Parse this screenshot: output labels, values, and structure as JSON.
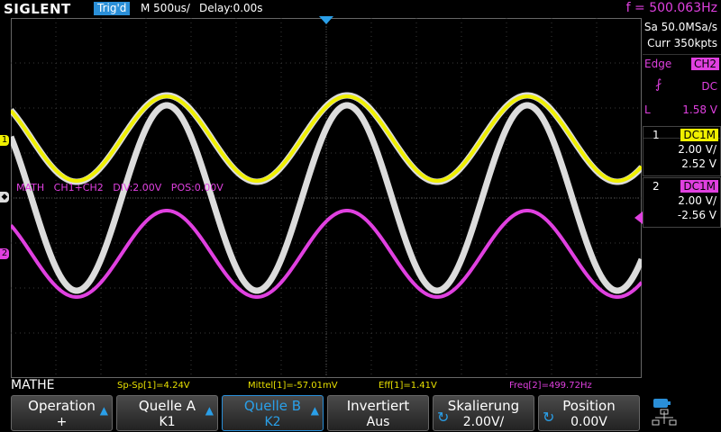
{
  "brand": "SIGLENT",
  "top": {
    "trigger_status": "Trig'd",
    "timebase": "M 500us/",
    "delay": "Delay:0.00s",
    "frequency": "f = 500.063Hz"
  },
  "right_panel": {
    "sample_rate": "Sa 50.0MSa/s",
    "memory": "Curr 350kpts",
    "trigger": {
      "type": "Edge",
      "source": "CH2",
      "slope_symbol": "⨏",
      "coupling": "DC",
      "level_label": "L",
      "level": "1.58 V"
    },
    "channels": [
      {
        "number": "1",
        "coupling": "DC1M",
        "scale": "2.00 V/",
        "offset": "2.52 V",
        "color": "#f0f000"
      },
      {
        "number": "2",
        "coupling": "DC1M",
        "scale": "2.00 V/",
        "offset": "-2.56 V",
        "color": "#e040e0"
      }
    ]
  },
  "math_label": "MATH   CH1+CH2   DIV:2.00V   POS:0.00V",
  "channel_markers": {
    "ch1": "1",
    "ch2": "2"
  },
  "measurement": {
    "menu_title": "MATHE",
    "items": [
      {
        "text": "Sp-Sp[1]=4.24V",
        "color": "#e8e000"
      },
      {
        "text": "Mittel[1]=-57.01mV",
        "color": "#e8e000"
      },
      {
        "text": "Eff[1]=1.41V",
        "color": "#e8e000"
      },
      {
        "text": "Freq[2]=499.72Hz",
        "color": "#e040e0"
      }
    ]
  },
  "softkeys": [
    {
      "label": "Operation",
      "value": "+",
      "arrow": true,
      "knob": false,
      "active": false
    },
    {
      "label": "Quelle A",
      "value": "K1",
      "arrow": true,
      "knob": false,
      "active": false
    },
    {
      "label": "Quelle B",
      "value": "K2",
      "arrow": true,
      "knob": false,
      "active": true
    },
    {
      "label": "Invertiert",
      "value": "Aus",
      "arrow": false,
      "knob": false,
      "active": false
    },
    {
      "label": "Skalierung",
      "value": "2.00V/",
      "arrow": false,
      "knob": true,
      "active": false
    },
    {
      "label": "Position",
      "value": "0.00V",
      "arrow": false,
      "knob": true,
      "active": false
    }
  ],
  "waveforms": {
    "frequency_hz": 500,
    "timebase_s_per_div": 0.0005,
    "ch1": {
      "color": "#f0f000"
    },
    "ch2": {
      "color": "#e040e0"
    },
    "math": {
      "color": "#dcdcdc"
    }
  },
  "colors": {
    "grid": "#3a3a3a",
    "grid_dots": "#555555",
    "accent": "#2a8fd8",
    "ch1": "#f0f000",
    "ch2": "#e040e0"
  }
}
